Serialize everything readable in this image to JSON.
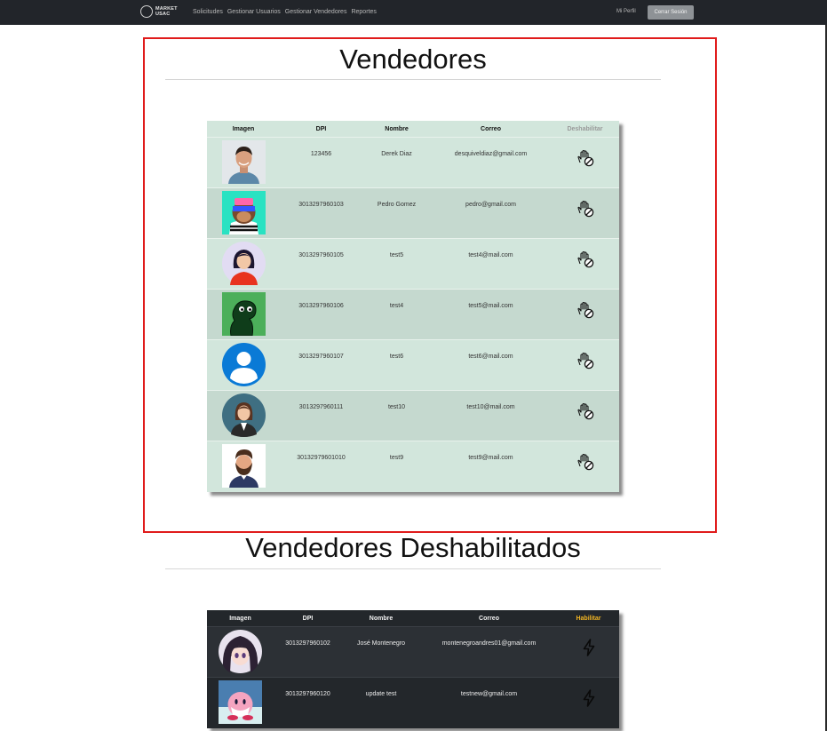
{
  "nav": {
    "brand_line1": "MARKET",
    "brand_line2": "USAC",
    "links": [
      "Solicitudes",
      "Gestionar Usuarios",
      "Gestionar Vendedores",
      "Reportes"
    ],
    "profile": "Mi Perfil",
    "logout": "Cerrar Sesión"
  },
  "active_section": {
    "title": "Vendedores",
    "headers": [
      "Imagen",
      "DPI",
      "Nombre",
      "Correo",
      "Deshabilitar"
    ],
    "rows": [
      {
        "dpi": "123456",
        "name": "Derek Diaz",
        "email": "desquiveldiaz@gmail.com",
        "avatar": "man-photo"
      },
      {
        "dpi": "3013297960103",
        "name": "Pedro Gomez",
        "email": "pedro@gmail.com",
        "avatar": "ape-nft"
      },
      {
        "dpi": "3013297960105",
        "name": "test5",
        "email": "test4@mail.com",
        "avatar": "woman-cartoon"
      },
      {
        "dpi": "3013297960106",
        "name": "test4",
        "email": "test5@mail.com",
        "avatar": "dinosaur"
      },
      {
        "dpi": "3013297960107",
        "name": "test6",
        "email": "test6@mail.com",
        "avatar": "default-user"
      },
      {
        "dpi": "3013297960111",
        "name": "test10",
        "email": "test10@mail.com",
        "avatar": "woman-suit"
      },
      {
        "dpi": "30132979601010",
        "name": "test9",
        "email": "test9@mail.com",
        "avatar": "bearded-man"
      }
    ],
    "action_icon": "hand-block-icon"
  },
  "disabled_section": {
    "title": "Vendedores Deshabilitados",
    "headers": [
      "Imagen",
      "DPI",
      "Nombre",
      "Correo",
      "Habilitar"
    ],
    "rows": [
      {
        "dpi": "3013297960102",
        "name": "José Montenegro",
        "email": "montenegroandres01@gmail.com",
        "avatar": "anime-girl"
      },
      {
        "dpi": "3013297960120",
        "name": "update test",
        "email": "testnew@gmail.com",
        "avatar": "kirby"
      }
    ],
    "action_icon": "lightning-icon"
  },
  "colors": {
    "highlight": "#e01b1b",
    "habilitar_header": "#f0b423",
    "navbar": "#22252a"
  }
}
